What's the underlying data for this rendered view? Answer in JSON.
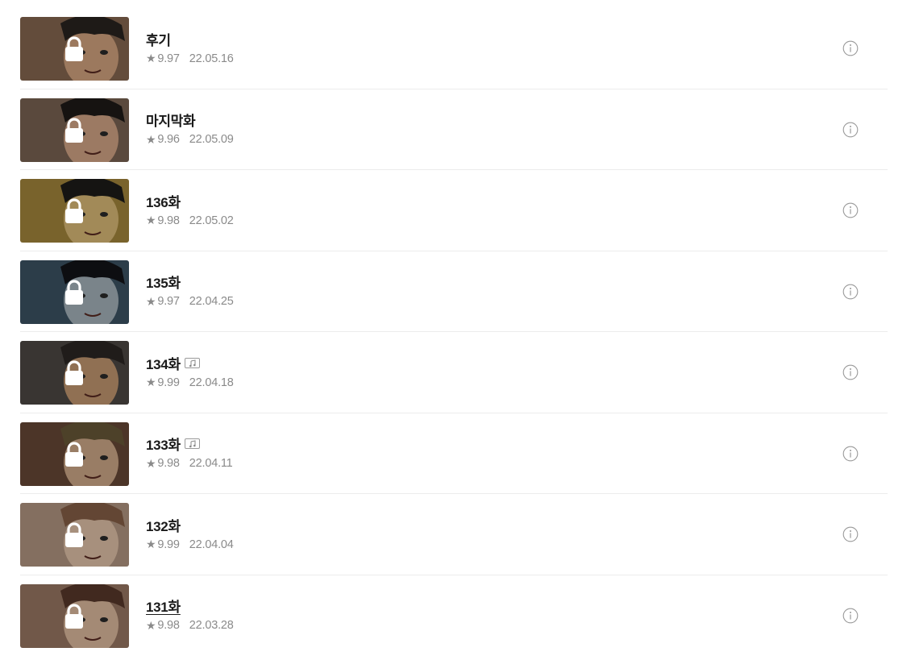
{
  "episodes": [
    {
      "title": "후기",
      "rating": "9.97",
      "date": "22.05.16",
      "bgm": false,
      "thumb": "#8a6a52",
      "hair": "#2a2420",
      "skin": "#d9a883",
      "underlined": false
    },
    {
      "title": "마지막화",
      "rating": "9.96",
      "date": "22.05.09",
      "bgm": false,
      "thumb": "#7d6655",
      "hair": "#1f1b18",
      "skin": "#d8a98a",
      "underlined": false
    },
    {
      "title": "136화",
      "rating": "9.98",
      "date": "22.05.02",
      "bgm": false,
      "thumb": "#a88a3e",
      "hair": "#1e1c1a",
      "skin": "#e1c07a",
      "underlined": false
    },
    {
      "title": "135화",
      "rating": "9.97",
      "date": "22.04.25",
      "bgm": false,
      "thumb": "#3d5566",
      "hair": "#121418",
      "skin": "#a9b7c0",
      "underlined": false
    },
    {
      "title": "134화",
      "rating": "9.99",
      "date": "22.04.18",
      "bgm": true,
      "thumb": "#4f4a46",
      "hair": "#2d2825",
      "skin": "#c89b73",
      "underlined": false
    },
    {
      "title": "133화",
      "rating": "9.98",
      "date": "22.04.11",
      "bgm": true,
      "thumb": "#6a4a38",
      "hair": "#6b5a3a",
      "skin": "#d5ae8c",
      "underlined": false
    },
    {
      "title": "132화",
      "rating": "9.99",
      "date": "22.04.04",
      "bgm": false,
      "thumb": "#b89a86",
      "hair": "#8a6248",
      "skin": "#e8c8ae",
      "underlined": false
    },
    {
      "title": "131화",
      "rating": "9.98",
      "date": "22.03.28",
      "bgm": false,
      "thumb": "#9d7a66",
      "hair": "#5a3a2c",
      "skin": "#e3bfa3",
      "underlined": true
    }
  ],
  "icons": {
    "star": "star-icon",
    "lock": "lock-icon",
    "bgm": "music-note-icon",
    "info": "info-icon"
  },
  "colors": {
    "title": "#1a1a1a",
    "meta": "#8a8a8a",
    "divider": "#ececec"
  }
}
